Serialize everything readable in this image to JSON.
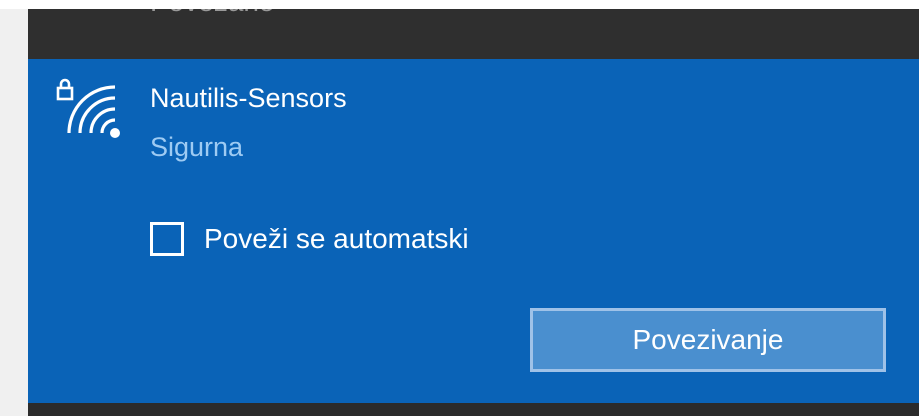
{
  "previous_network": {
    "status": "Povezano"
  },
  "network": {
    "name": "Nautilis-Sensors",
    "security": "Sigurna",
    "icon": "wifi-secured-icon",
    "connect_automatically": {
      "label": "Poveži se automatski",
      "checked": false
    },
    "connect_button_label": "Povezivanje"
  },
  "colors": {
    "card_background": "#0a63b7",
    "flyout_background": "#2b2b2b",
    "security_text": "#9ecbf3",
    "button_background": "#4a8fcf",
    "button_border": "#9fc2e8"
  }
}
